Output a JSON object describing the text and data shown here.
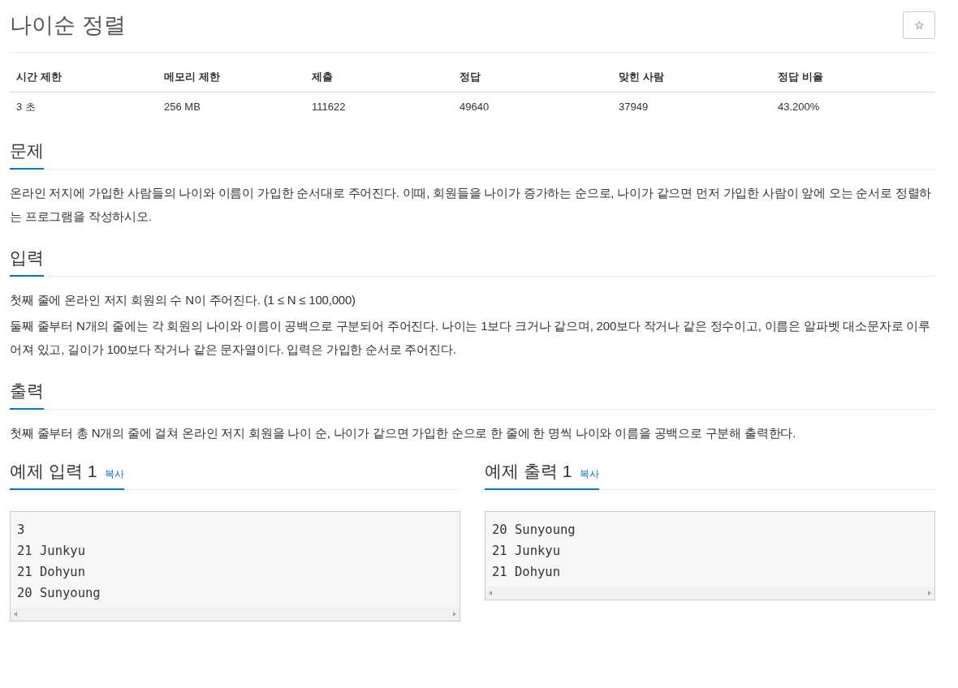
{
  "title": "나이순 정렬",
  "star_button": "☆",
  "stats": {
    "columns": [
      "시간 제한",
      "메모리 제한",
      "제출",
      "정답",
      "맞힌 사람",
      "정답 비율"
    ],
    "row": [
      "3 초",
      "256 MB",
      "111622",
      "49640",
      "37949",
      "43.200%"
    ]
  },
  "sections": [
    {
      "heading": "문제",
      "paragraphs": [
        "온라인 저지에 가입한 사람들의 나이와 이름이 가입한 순서대로 주어진다. 이때, 회원들을 나이가 증가하는 순으로, 나이가 같으면 먼저 가입한 사람이 앞에 오는 순서로 정렬하는 프로그램을 작성하시오."
      ]
    },
    {
      "heading": "입력",
      "paragraphs": [
        "첫째 줄에 온라인 저지 회원의 수 N이 주어진다. (1 ≤ N ≤ 100,000)",
        "둘째 줄부터 N개의 줄에는 각 회원의 나이와 이름이 공백으로 구분되어 주어진다. 나이는 1보다 크거나 같으며, 200보다 작거나 같은 정수이고, 이름은 알파벳 대소문자로 이루어져 있고, 길이가 100보다 작거나 같은 문자열이다. 입력은 가입한 순서로 주어진다."
      ]
    },
    {
      "heading": "출력",
      "paragraphs": [
        "첫째 줄부터 총 N개의 줄에 걸쳐 온라인 저지 회원을 나이 순, 나이가 같으면 가입한 순으로 한 줄에 한 명씩 나이와 이름을 공백으로 구분해 출력한다."
      ]
    }
  ],
  "samples": [
    {
      "title": "예제 입력 1",
      "copy_label": "복사",
      "lines": [
        "3",
        "21 Junkyu",
        "21 Dohyun",
        "20 Sunyoung"
      ]
    },
    {
      "title": "예제 출력 1",
      "copy_label": "복사",
      "lines": [
        "20 Sunyoung",
        "21 Junkyu",
        "21 Dohyun"
      ]
    }
  ]
}
